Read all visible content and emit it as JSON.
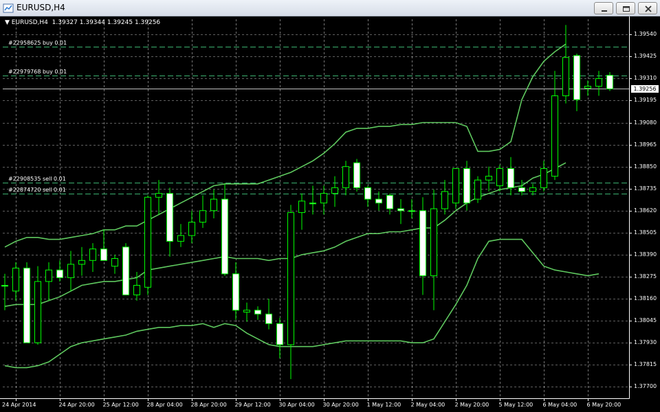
{
  "window": {
    "title": "EURUSD,H4"
  },
  "header": {
    "symbol_tf": "EURUSD,H4",
    "open": "1.39327",
    "high": "1.39344",
    "low": "1.39245",
    "close": "1.39256"
  },
  "orders": [
    {
      "label": "#22958625 buy 0.01",
      "price": 1.39475
    },
    {
      "label": "#22979768 buy 0.01",
      "price": 1.39325
    },
    {
      "label": "#22908535 sell 0.01",
      "price": 1.38768
    },
    {
      "label": "#22874720 sell 0.01",
      "price": 1.38708
    }
  ],
  "current_price": {
    "label": "1.39256",
    "value": 1.39256
  },
  "colors": {
    "background": "#000000",
    "grid": "#c0c0c0",
    "candle_up": "#000000",
    "candle_down": "#ffffff",
    "wick": "#00ff00",
    "bands": "#5fc95f",
    "order_line": "#3cb371"
  },
  "icons": {
    "window": "chart-window-icon",
    "minimize": "minimize-icon",
    "maximize": "restore-icon",
    "close": "close-icon"
  },
  "chart_data": {
    "type": "candlestick",
    "symbol": "EURUSD",
    "timeframe": "H4",
    "ylim": [
      1.3764,
      1.3962
    ],
    "y_ticks": [
      1.3954,
      1.39425,
      1.3931,
      1.39195,
      1.3908,
      1.38965,
      1.3885,
      1.38735,
      1.3862,
      1.38505,
      1.3839,
      1.38275,
      1.3816,
      1.38045,
      1.3793,
      1.37815,
      1.377
    ],
    "y_tick_labels": [
      "1.39540",
      "1.39425",
      "1.39310",
      "1.39195",
      "1.39080",
      "1.38965",
      "1.38850",
      "1.38735",
      "1.38620",
      "1.38505",
      "1.38390",
      "1.38275",
      "1.38160",
      "1.38045",
      "1.37930",
      "1.37815",
      "1.37700"
    ],
    "x_labels": [
      {
        "bar": 1,
        "text": "24 Apr 2014"
      },
      {
        "bar": 5,
        "text": "24 Apr 20:00"
      },
      {
        "bar": 9,
        "text": "25 Apr 12:00"
      },
      {
        "bar": 13,
        "text": "28 Apr 04:00"
      },
      {
        "bar": 17,
        "text": "28 Apr 20:00"
      },
      {
        "bar": 21,
        "text": "29 Apr 12:00"
      },
      {
        "bar": 25,
        "text": "30 Apr 04:00"
      },
      {
        "bar": 29,
        "text": "30 Apr 20:00"
      },
      {
        "bar": 33,
        "text": "1 May 12:00"
      },
      {
        "bar": 37,
        "text": "2 May 04:00"
      },
      {
        "bar": 41,
        "text": "2 May 20:00"
      },
      {
        "bar": 45,
        "text": "5 May 12:00"
      },
      {
        "bar": 49,
        "text": "6 May 04:00"
      },
      {
        "bar": 53,
        "text": "6 May 20:00"
      }
    ],
    "ohlc": [
      {
        "o": 1.3823,
        "h": 1.3829,
        "l": 1.381,
        "c": 1.3823
      },
      {
        "o": 1.382,
        "h": 1.3835,
        "l": 1.3815,
        "c": 1.3832
      },
      {
        "o": 1.3832,
        "h": 1.3835,
        "l": 1.3793,
        "c": 1.3793
      },
      {
        "o": 1.3793,
        "h": 1.3833,
        "l": 1.3792,
        "c": 1.3825
      },
      {
        "o": 1.3825,
        "h": 1.3835,
        "l": 1.3815,
        "c": 1.3831
      },
      {
        "o": 1.3831,
        "h": 1.3836,
        "l": 1.3825,
        "c": 1.3827
      },
      {
        "o": 1.3827,
        "h": 1.3841,
        "l": 1.382,
        "c": 1.3834
      },
      {
        "o": 1.3834,
        "h": 1.3843,
        "l": 1.3828,
        "c": 1.3836
      },
      {
        "o": 1.3836,
        "h": 1.3845,
        "l": 1.383,
        "c": 1.3842
      },
      {
        "o": 1.3842,
        "h": 1.3852,
        "l": 1.3836,
        "c": 1.3836
      },
      {
        "o": 1.3833,
        "h": 1.3839,
        "l": 1.3829,
        "c": 1.3837
      },
      {
        "o": 1.3843,
        "h": 1.3845,
        "l": 1.3818,
        "c": 1.3818
      },
      {
        "o": 1.3818,
        "h": 1.383,
        "l": 1.3815,
        "c": 1.3823
      },
      {
        "o": 1.3822,
        "h": 1.387,
        "l": 1.3818,
        "c": 1.3869
      },
      {
        "o": 1.3869,
        "h": 1.3878,
        "l": 1.386,
        "c": 1.3871
      },
      {
        "o": 1.3871,
        "h": 1.3874,
        "l": 1.3838,
        "c": 1.3846
      },
      {
        "o": 1.3846,
        "h": 1.3855,
        "l": 1.3843,
        "c": 1.3849
      },
      {
        "o": 1.3849,
        "h": 1.3862,
        "l": 1.3845,
        "c": 1.3856
      },
      {
        "o": 1.3856,
        "h": 1.387,
        "l": 1.3853,
        "c": 1.3862
      },
      {
        "o": 1.3862,
        "h": 1.3873,
        "l": 1.3858,
        "c": 1.3868
      },
      {
        "o": 1.3868,
        "h": 1.3876,
        "l": 1.3828,
        "c": 1.3829
      },
      {
        "o": 1.3829,
        "h": 1.3835,
        "l": 1.3805,
        "c": 1.381
      },
      {
        "o": 1.3809,
        "h": 1.3814,
        "l": 1.3804,
        "c": 1.381
      },
      {
        "o": 1.381,
        "h": 1.3812,
        "l": 1.3805,
        "c": 1.3808
      },
      {
        "o": 1.3808,
        "h": 1.3816,
        "l": 1.38,
        "c": 1.3803
      },
      {
        "o": 1.3803,
        "h": 1.3806,
        "l": 1.3785,
        "c": 1.3792
      },
      {
        "o": 1.3792,
        "h": 1.3865,
        "l": 1.3774,
        "c": 1.3861
      },
      {
        "o": 1.3861,
        "h": 1.3871,
        "l": 1.3852,
        "c": 1.3867
      },
      {
        "o": 1.3866,
        "h": 1.3875,
        "l": 1.386,
        "c": 1.3866
      },
      {
        "o": 1.3866,
        "h": 1.3875,
        "l": 1.386,
        "c": 1.3871
      },
      {
        "o": 1.3871,
        "h": 1.388,
        "l": 1.3864,
        "c": 1.3874
      },
      {
        "o": 1.3874,
        "h": 1.3888,
        "l": 1.387,
        "c": 1.3885
      },
      {
        "o": 1.3887,
        "h": 1.3889,
        "l": 1.3872,
        "c": 1.3874
      },
      {
        "o": 1.3874,
        "h": 1.3875,
        "l": 1.3864,
        "c": 1.3868
      },
      {
        "o": 1.3868,
        "h": 1.3872,
        "l": 1.3862,
        "c": 1.3866
      },
      {
        "o": 1.387,
        "h": 1.3871,
        "l": 1.386,
        "c": 1.3863
      },
      {
        "o": 1.3863,
        "h": 1.3868,
        "l": 1.3855,
        "c": 1.3862
      },
      {
        "o": 1.3862,
        "h": 1.3868,
        "l": 1.3858,
        "c": 1.3862
      },
      {
        "o": 1.3862,
        "h": 1.3869,
        "l": 1.3818,
        "c": 1.3828
      },
      {
        "o": 1.3828,
        "h": 1.3873,
        "l": 1.381,
        "c": 1.3863
      },
      {
        "o": 1.3863,
        "h": 1.3878,
        "l": 1.386,
        "c": 1.3872
      },
      {
        "o": 1.3866,
        "h": 1.3884,
        "l": 1.3863,
        "c": 1.3884
      },
      {
        "o": 1.3884,
        "h": 1.3888,
        "l": 1.3862,
        "c": 1.3866
      },
      {
        "o": 1.3868,
        "h": 1.388,
        "l": 1.3866,
        "c": 1.3878
      },
      {
        "o": 1.3878,
        "h": 1.3885,
        "l": 1.3872,
        "c": 1.388
      },
      {
        "o": 1.3875,
        "h": 1.3886,
        "l": 1.3872,
        "c": 1.3884
      },
      {
        "o": 1.3884,
        "h": 1.389,
        "l": 1.387,
        "c": 1.3874
      },
      {
        "o": 1.3874,
        "h": 1.3878,
        "l": 1.387,
        "c": 1.3872
      },
      {
        "o": 1.3872,
        "h": 1.3876,
        "l": 1.387,
        "c": 1.3874
      },
      {
        "o": 1.3874,
        "h": 1.3888,
        "l": 1.3872,
        "c": 1.3884
      },
      {
        "o": 1.388,
        "h": 1.3935,
        "l": 1.3878,
        "c": 1.3922
      },
      {
        "o": 1.3922,
        "h": 1.3959,
        "l": 1.3918,
        "c": 1.3942
      },
      {
        "o": 1.3943,
        "h": 1.3944,
        "l": 1.3914,
        "c": 1.392
      },
      {
        "o": 1.3926,
        "h": 1.393,
        "l": 1.3922,
        "c": 1.3927
      },
      {
        "o": 1.3927,
        "h": 1.3935,
        "l": 1.3922,
        "c": 1.3931
      },
      {
        "o": 1.39327,
        "h": 1.39344,
        "l": 1.39245,
        "c": 1.39256
      }
    ],
    "bollinger": {
      "upper": [
        1.3843,
        1.3846,
        1.3848,
        1.3848,
        1.3847,
        1.3847,
        1.3848,
        1.3849,
        1.385,
        1.3852,
        1.3852,
        1.3854,
        1.3854,
        1.3857,
        1.386,
        1.3863,
        1.3866,
        1.3869,
        1.3872,
        1.3875,
        1.3876,
        1.3876,
        1.3876,
        1.3876,
        1.3878,
        1.388,
        1.3882,
        1.3885,
        1.3888,
        1.3892,
        1.3897,
        1.3903,
        1.3905,
        1.3905,
        1.3906,
        1.3906,
        1.3907,
        1.3907,
        1.3908,
        1.3908,
        1.3908,
        1.3908,
        1.3906,
        1.3893,
        1.3893,
        1.3894,
        1.3898,
        1.392,
        1.3932,
        1.394,
        1.3945,
        1.3949
      ],
      "middle": [
        1.3812,
        1.3813,
        1.3813,
        1.3813,
        1.3815,
        1.3817,
        1.382,
        1.3823,
        1.3824,
        1.3825,
        1.3825,
        1.3826,
        1.3827,
        1.3831,
        1.3832,
        1.3833,
        1.3834,
        1.3835,
        1.3836,
        1.3837,
        1.3838,
        1.3837,
        1.3837,
        1.3837,
        1.3836,
        1.3837,
        1.3837,
        1.3839,
        1.384,
        1.3841,
        1.3843,
        1.3846,
        1.3848,
        1.385,
        1.385,
        1.3851,
        1.3851,
        1.3852,
        1.3853,
        1.3853,
        1.3857,
        1.3862,
        1.3866,
        1.3869,
        1.3871,
        1.3873,
        1.3874,
        1.3875,
        1.3879,
        1.3881,
        1.3884,
        1.3887
      ],
      "lower": [
        1.3781,
        1.378,
        1.378,
        1.3781,
        1.3783,
        1.3787,
        1.3791,
        1.3793,
        1.3794,
        1.3795,
        1.3796,
        1.3797,
        1.3799,
        1.38,
        1.3801,
        1.3801,
        1.3802,
        1.3802,
        1.3803,
        1.3801,
        1.3803,
        1.3802,
        1.3798,
        1.3795,
        1.3792,
        1.3791,
        1.3791,
        1.3791,
        1.3791,
        1.3792,
        1.3793,
        1.3794,
        1.3794,
        1.3794,
        1.3794,
        1.3794,
        1.3794,
        1.3793,
        1.3793,
        1.3795,
        1.3804,
        1.3813,
        1.3823,
        1.3837,
        1.3846,
        1.3847,
        1.3847,
        1.3847,
        1.384,
        1.3833,
        1.3831,
        1.383,
        1.3829,
        1.3828,
        1.3829
      ]
    }
  }
}
